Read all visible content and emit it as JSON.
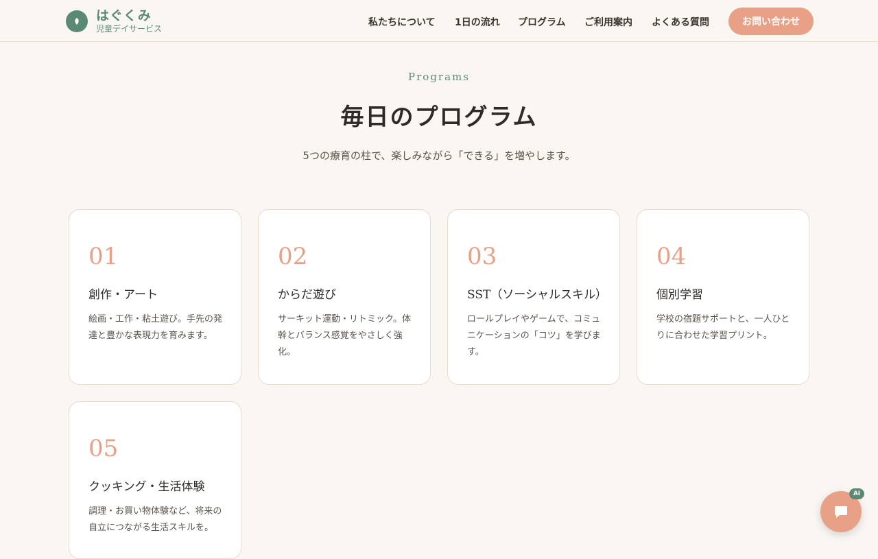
{
  "brand": {
    "name": "はぐくみ",
    "subtitle": "児童デイサービス"
  },
  "nav": {
    "items": [
      {
        "label": "私たちについて"
      },
      {
        "label": "1日の流れ"
      },
      {
        "label": "プログラム"
      },
      {
        "label": "ご利用案内"
      },
      {
        "label": "よくある質問"
      }
    ],
    "cta_label": "お問い合わせ"
  },
  "section": {
    "eyebrow": "Programs",
    "title": "毎日のプログラム",
    "lead": "5つの療育の柱で、楽しみながら「できる」を増やします。"
  },
  "cards": [
    {
      "num": "01",
      "title": "創作・アート",
      "desc": "絵画・工作・粘土遊び。手先の発達と豊かな表現力を育みます。"
    },
    {
      "num": "02",
      "title": "からだ遊び",
      "desc": "サーキット運動・リトミック。体幹とバランス感覚をやさしく強化。"
    },
    {
      "num": "03",
      "title": "SST（ソーシャルスキル）",
      "desc": "ロールプレイやゲームで、コミュニケーションの「コツ」を学びます。"
    },
    {
      "num": "04",
      "title": "個別学習",
      "desc": "学校の宿題サポートと、一人ひとりに合わせた学習プリント。"
    },
    {
      "num": "05",
      "title": "クッキング・生活体験",
      "desc": "調理・お買い物体験など、将来の自立につながる生活スキルを。"
    }
  ],
  "chat": {
    "badge": "AI"
  },
  "colors": {
    "background": "#faf7f2",
    "brand_green": "#5a8a74",
    "accent_coral": "#e8a086"
  }
}
